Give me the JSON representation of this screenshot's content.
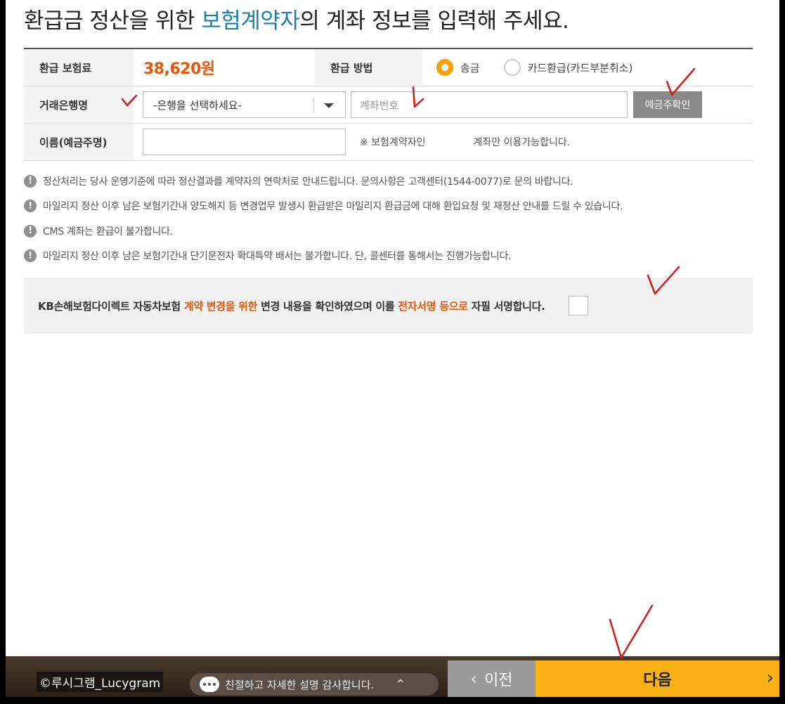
{
  "title": {
    "prefix": "환급금 정산을 위한 ",
    "highlight": "보험계약자",
    "suffix": "의 계좌 정보를 입력해 주세요.",
    "highlight_color": "#1b7ea8"
  },
  "form": {
    "refund_label": "환급 보험료",
    "refund_amount": "38,620원",
    "method_label": "환급 방법",
    "methods": [
      {
        "label": "송금",
        "selected": true
      },
      {
        "label": "카드환급(카드부분취소)",
        "selected": false
      }
    ],
    "bank_label": "거래은행명",
    "bank_select_value": "-은행을 선택하세요-",
    "account_placeholder": "계좌번호",
    "verify_button": "예금주확인",
    "name_label": "이름(예금주명)",
    "name_value": "",
    "name_note_prefix": "※ 보험계약자인",
    "name_note_suffix": "계좌만 이용가능합니다."
  },
  "notices": [
    "정산처리는 당사 운영기준에 따라 정산결과를 계약자의 연락처로 안내드립니다. 문의사항은 고객센터(1544-0077)로 문의 바랍니다.",
    "마일리지 정산 이후 남은 보험기간내 양도해지 등 변경업무 발생시 환급받은 마일리지 환급금에 대해 환입요청 및 재정산 안내를 드릴 수 있습니다.",
    "CMS 계좌는 환급이 불가합니다.",
    "마일리지 정산 이후 남은 보험기간내 단기운전자 확대특약 배서는 불가합니다. 단, 콜센터를 통해서는 진행가능합니다."
  ],
  "agreement": {
    "part1": "KB손해보험다이렉트 자동차보험 ",
    "part2": "계약 변경을 위한",
    "part3": " 변경 내용을 확인하였으며 이를 ",
    "part4": "전자서명 등으로",
    "part5": " 자필 서명합니다.",
    "checked": false
  },
  "bottom_bar": {
    "watermark": "©루시그램_Lucygram",
    "chat_text": "친절하고 자세한 설명 감사합니다.",
    "prev_label": "이전",
    "next_label": "다음"
  },
  "colors": {
    "accent_orange": "#e8560a",
    "radio_on": "#f5a20a",
    "next_button": "#f9b116",
    "annotation_red": "#d61a1a"
  }
}
